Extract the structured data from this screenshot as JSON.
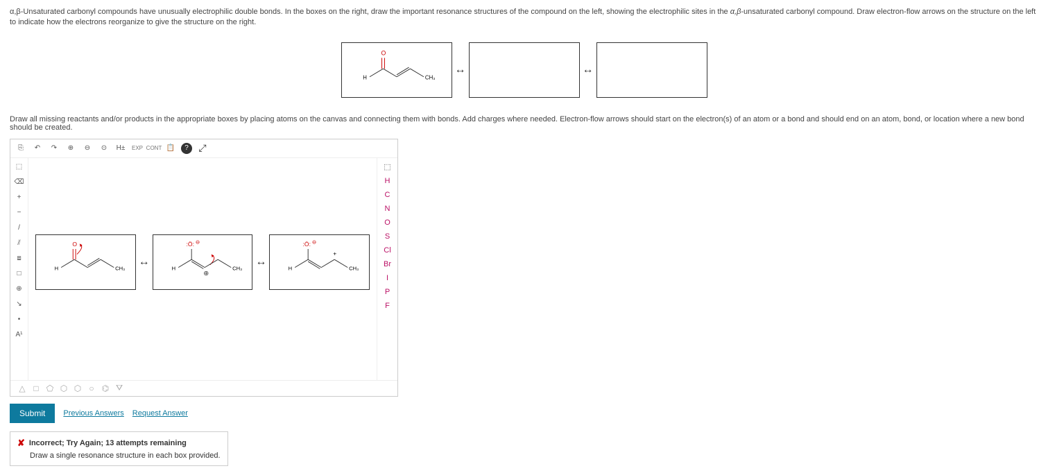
{
  "question": {
    "text_part1": "α,β-Unsaturated carbonyl compounds have unusually electrophilic double bonds. In the boxes on the right, draw the important resonance structures of the compound on the left, showing the electrophilic sites in the ",
    "text_italic": "α,β",
    "text_part2": "-unsaturated carbonyl compound. Draw electron-flow arrows on the structure on the left to indicate how the electrons reorganize to give the structure on the right."
  },
  "top_boxes": {
    "compound_label_O": "O",
    "compound_label_H": "H",
    "compound_label_CH3": "CH₃",
    "arrow": "↔"
  },
  "instruction2": "Draw all missing reactants and/or products in the appropriate boxes by placing atoms on the canvas and connecting them with bonds. Add charges where needed. Electron-flow arrows should start on the electron(s) of an atom or a bond and should end on an atom, bond, or location where a new bond should be created.",
  "toolbar_top": {
    "new": "⎘",
    "undo": "↶",
    "redo": "↷",
    "zoom_in": "⊕",
    "zoom_out": "⊖",
    "zoom_fit": "⊙",
    "h_toggle": "H±",
    "exp": "EXP",
    "cont": "CONT",
    "clipboard": "📋",
    "help": "?",
    "expand": "⤢"
  },
  "left_tools": {
    "select": "⬚",
    "erase": "⌫",
    "plus": "+",
    "minus": "−",
    "bond": "/",
    "double": "⫽",
    "group_lock": "⧈",
    "box": "□",
    "plus_dot": "⊕",
    "arrow_tool": "↘",
    "dot": "•",
    "label": "A¹"
  },
  "right_atoms": {
    "marquee": "⬚",
    "H": "H",
    "C": "C",
    "N": "N",
    "O": "O",
    "S": "S",
    "Cl": "Cl",
    "Br": "Br",
    "I": "I",
    "P": "P",
    "F": "F"
  },
  "canvas_molecules": {
    "mol1_O": "O",
    "mol1_H": "H",
    "mol1_CH3": "CH₃",
    "mol2_O": ":Ö:",
    "mol2_neg": "⊖",
    "mol2_H": "H",
    "mol2_pos": "⊕",
    "mol2_CH3": "CH₃",
    "mol3_O": ":Ö:",
    "mol3_neg": "⊖",
    "mol3_H": "H",
    "mol3_pos": "+",
    "mol3_CH3": "CH₃",
    "arrow": "↔"
  },
  "bottom_shapes": {
    "triangle": "△",
    "square": "□",
    "pentagon": "⬠",
    "hexagon": "⬡",
    "heptagon": "⬡",
    "hex2": "○",
    "benzene": "⌬",
    "chair": "⛛"
  },
  "actions": {
    "submit": "Submit",
    "previous": "Previous Answers",
    "request": "Request Answer"
  },
  "feedback": {
    "icon": "✘",
    "header": "Incorrect; Try Again; 13 attempts remaining",
    "detail": "Draw a single resonance structure in each box provided."
  }
}
